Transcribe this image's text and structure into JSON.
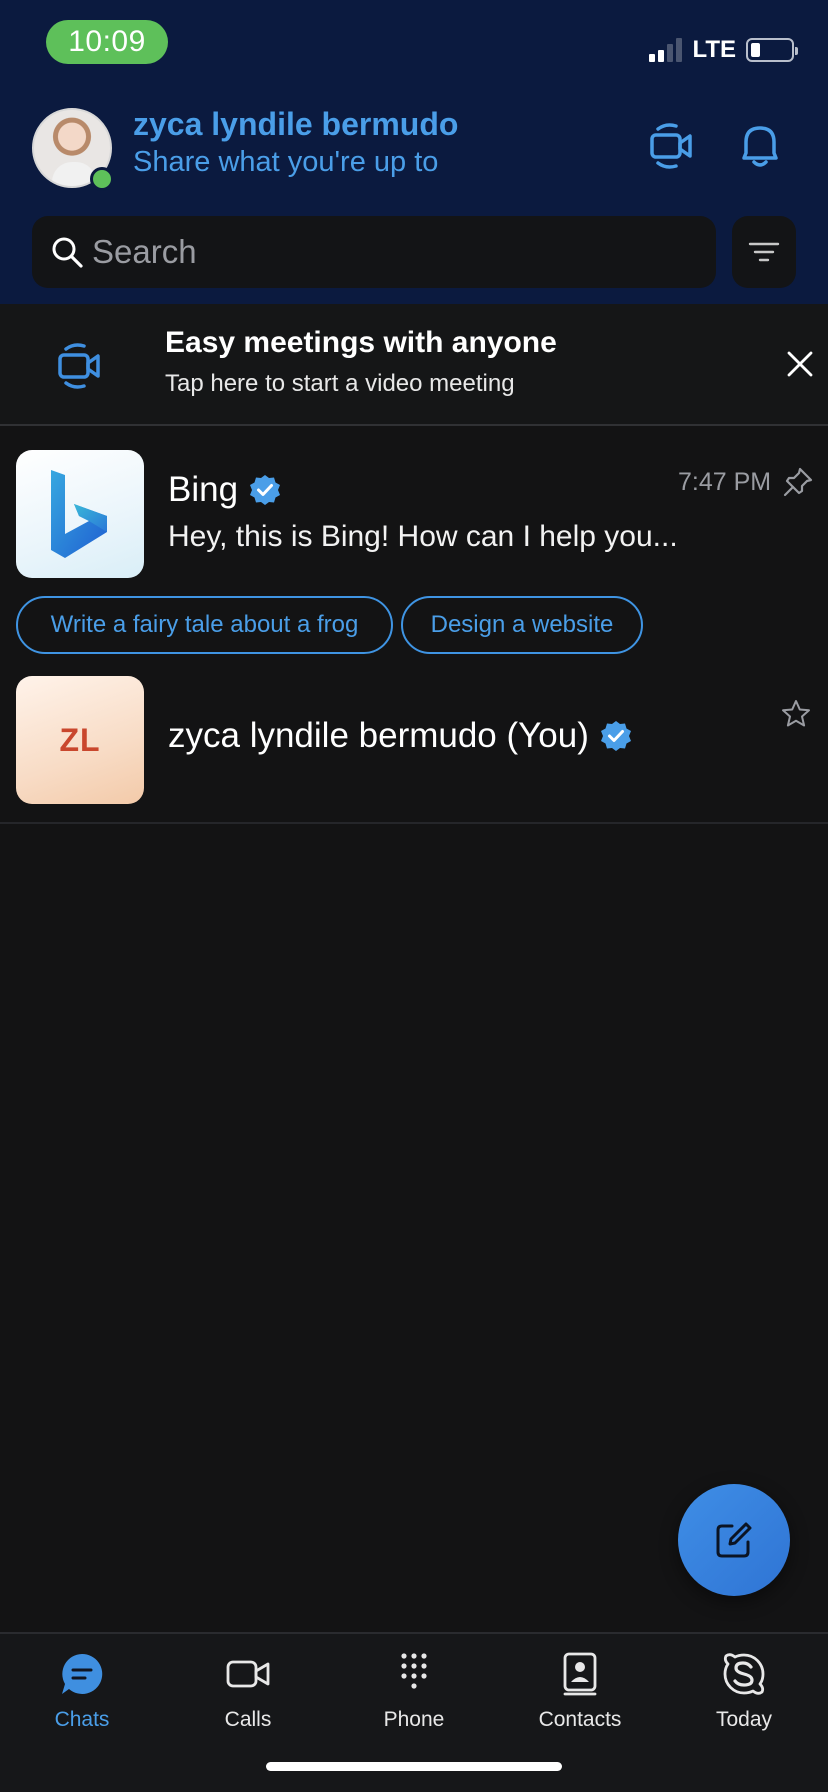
{
  "status_bar": {
    "time": "10:09",
    "network": "LTE",
    "time_pill_color": "#5ec05a",
    "signal_bars_active": 2,
    "signal_bars_total": 4,
    "battery_level": 0.2
  },
  "header": {
    "user_name": "zyca lyndile bermudo",
    "status_prompt": "Share what you're up to",
    "presence": "online",
    "background_color": "#0b1a3f",
    "accent_color": "#4a9ee8",
    "icons": [
      "video-meeting-icon",
      "bell-icon"
    ]
  },
  "search": {
    "placeholder": "Search",
    "value": "",
    "filter_icon": "filter-icon"
  },
  "banner": {
    "title": "Easy meetings with anyone",
    "subtitle": "Tap here to start a video meeting",
    "icon": "video-meeting-icon",
    "close_icon": "close-icon"
  },
  "chats": [
    {
      "name": "Bing",
      "verified": true,
      "time": "7:47 PM",
      "preview": "Hey, this is Bing! How can I help you...",
      "pinned": true,
      "avatar_icon": "bing-logo-icon",
      "suggestions": [
        "Write a fairy tale about a frog",
        "Design a website"
      ]
    },
    {
      "name": "zyca lyndile bermudo (You)",
      "verified": true,
      "initials": "ZL",
      "favorite": false
    }
  ],
  "fab": {
    "icon": "compose-icon"
  },
  "nav": {
    "items": [
      {
        "label": "Chats",
        "icon": "chat-bubble-icon",
        "active": true
      },
      {
        "label": "Calls",
        "icon": "video-camera-icon",
        "active": false
      },
      {
        "label": "Phone",
        "icon": "dialpad-icon",
        "active": false
      },
      {
        "label": "Contacts",
        "icon": "contacts-book-icon",
        "active": false
      },
      {
        "label": "Today",
        "icon": "skype-icon",
        "active": false
      }
    ],
    "active_color": "#4a9ee8"
  }
}
